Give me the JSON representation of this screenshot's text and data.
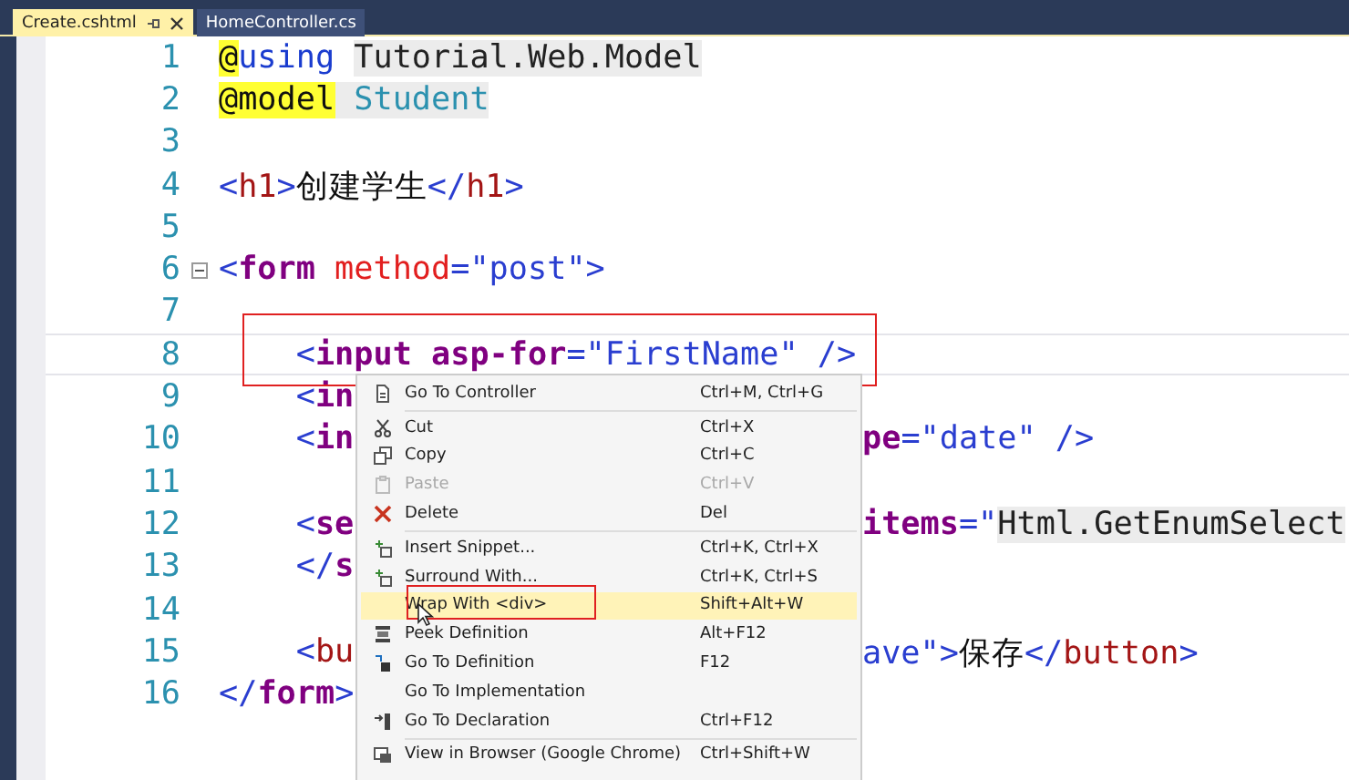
{
  "tabs": [
    {
      "label": "Create.cshtml",
      "selected": true
    },
    {
      "label": "HomeController.cs",
      "selected": false
    }
  ],
  "code_lines": [
    {
      "number": "1",
      "left": [
        {
          "text": "@",
          "kind": "razor"
        },
        {
          "text": "using ",
          "kind": "keyword"
        },
        {
          "text": "Tutorial.Web.Model",
          "kind": "razorexpr"
        }
      ]
    },
    {
      "number": "2",
      "left": [
        {
          "text": "@model",
          "kind": "razor"
        },
        {
          "text": " Student",
          "kind": "typeexpr"
        }
      ]
    },
    {
      "number": "3"
    },
    {
      "number": "4",
      "left": [
        {
          "text": "<",
          "kind": "punct"
        },
        {
          "text": "h1",
          "kind": "element"
        },
        {
          "text": ">",
          "kind": "punct"
        },
        {
          "text": "创建学生",
          "kind": "plain"
        },
        {
          "text": "</",
          "kind": "punct"
        },
        {
          "text": "h1",
          "kind": "element"
        },
        {
          "text": ">",
          "kind": "punct"
        }
      ]
    },
    {
      "number": "5"
    },
    {
      "number": "6",
      "collapsible": true,
      "left": [
        {
          "text": "<",
          "kind": "punct"
        },
        {
          "text": "form",
          "kind": "helper"
        },
        {
          "text": " method",
          "kind": "attr"
        },
        {
          "text": "=\"post\">",
          "kind": "punct"
        }
      ]
    },
    {
      "number": "7"
    },
    {
      "number": "8",
      "current": true,
      "left": [
        {
          "text": "    <",
          "kind": "punct"
        },
        {
          "text": "input",
          "kind": "helper"
        },
        {
          "text": " asp-for",
          "kind": "helper"
        },
        {
          "text": "=\"FirstName\" />",
          "kind": "punct"
        }
      ]
    },
    {
      "number": "9",
      "left": [
        {
          "text": "    <",
          "kind": "punct"
        },
        {
          "text": "in",
          "kind": "helper"
        }
      ]
    },
    {
      "number": "10",
      "left": [
        {
          "text": "    <",
          "kind": "punct"
        },
        {
          "text": "in",
          "kind": "helper"
        }
      ],
      "right": [
        {
          "text": "pe",
          "kind": "helper"
        },
        {
          "text": "=\"date\" />",
          "kind": "punct"
        }
      ]
    },
    {
      "number": "11"
    },
    {
      "number": "12",
      "left": [
        {
          "text": "    <",
          "kind": "punct"
        },
        {
          "text": "se",
          "kind": "helper"
        }
      ],
      "right": [
        {
          "text": "items",
          "kind": "helper"
        },
        {
          "text": "=\"",
          "kind": "punct"
        },
        {
          "text": "Html.GetEnumSelect",
          "kind": "razorexpr"
        }
      ]
    },
    {
      "number": "13",
      "left": [
        {
          "text": "    </",
          "kind": "punct"
        },
        {
          "text": "s",
          "kind": "helper"
        }
      ]
    },
    {
      "number": "14"
    },
    {
      "number": "15",
      "left": [
        {
          "text": "    <",
          "kind": "punct"
        },
        {
          "text": "bu",
          "kind": "element"
        }
      ],
      "right": [
        {
          "text": "ave\">",
          "kind": "punct"
        },
        {
          "text": "保存",
          "kind": "plain"
        },
        {
          "text": "</",
          "kind": "punct"
        },
        {
          "text": "button",
          "kind": "element"
        },
        {
          "text": ">",
          "kind": "punct"
        }
      ]
    },
    {
      "number": "16",
      "left": [
        {
          "text": "</",
          "kind": "punct"
        },
        {
          "text": "form",
          "kind": "helper"
        },
        {
          "text": ">",
          "kind": "punct"
        }
      ]
    }
  ],
  "context_menu": {
    "items": [
      {
        "label": "Go To Controller",
        "shortcut": "Ctrl+M, Ctrl+G",
        "disabled": false,
        "selected": false,
        "separator_after": true
      },
      {
        "label": "Cut",
        "shortcut": "Ctrl+X",
        "disabled": false,
        "selected": false,
        "separator_after": false
      },
      {
        "label": "Copy",
        "shortcut": "Ctrl+C",
        "disabled": false,
        "selected": false,
        "separator_after": false
      },
      {
        "label": "Paste",
        "shortcut": "Ctrl+V",
        "disabled": true,
        "selected": false,
        "separator_after": false
      },
      {
        "label": "Delete",
        "shortcut": "Del",
        "disabled": false,
        "selected": false,
        "separator_after": true
      },
      {
        "label": "Insert Snippet...",
        "shortcut": "Ctrl+K, Ctrl+X",
        "disabled": false,
        "selected": false,
        "separator_after": false
      },
      {
        "label": "Surround With...",
        "shortcut": "Ctrl+K, Ctrl+S",
        "disabled": false,
        "selected": false,
        "separator_after": false
      },
      {
        "label": "Wrap With <div>",
        "shortcut": "Shift+Alt+W",
        "disabled": false,
        "selected": true,
        "separator_after": false
      },
      {
        "label": "Peek Definition",
        "shortcut": "Alt+F12",
        "disabled": false,
        "selected": false,
        "separator_after": false
      },
      {
        "label": "Go To Definition",
        "shortcut": "F12",
        "disabled": false,
        "selected": false,
        "separator_after": false
      },
      {
        "label": "Go To Implementation",
        "disabled": false,
        "selected": false,
        "separator_after": false
      },
      {
        "label": "Go To Declaration",
        "shortcut": "Ctrl+F12",
        "disabled": false,
        "selected": false,
        "separator_after": true
      },
      {
        "label": "View in Browser (Google Chrome)",
        "shortcut": "Ctrl+Shift+W",
        "disabled": false,
        "selected": false,
        "separator_after": false
      }
    ]
  }
}
